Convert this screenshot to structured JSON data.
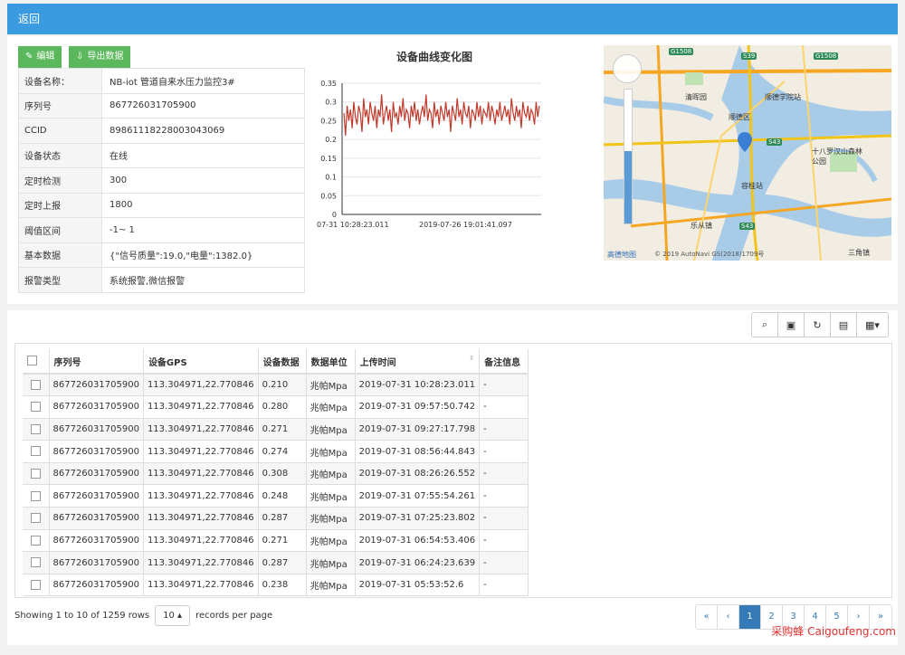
{
  "header": {
    "back_label": "返回"
  },
  "actions": {
    "edit_label": "编辑",
    "export_label": "导出数据"
  },
  "device": [
    {
      "key": "设备名称：",
      "value": "NB-iot 管道自来水压力监控3#"
    },
    {
      "key": "序列号",
      "value": "867726031705900"
    },
    {
      "key": "CCID",
      "value": "89861118228003043069"
    },
    {
      "key": "设备状态",
      "value": "在线"
    },
    {
      "key": "定时检测",
      "value": "300"
    },
    {
      "key": "定时上报",
      "value": "1800"
    },
    {
      "key": "阈值区间",
      "value": "-1~ 1"
    },
    {
      "key": "基本数据",
      "value": "{\"信号质量\":19.0,\"电量\":1382.0}"
    },
    {
      "key": "报警类型",
      "value": "系统报警,微信报警"
    }
  ],
  "chart_data": {
    "type": "line",
    "title": "设备曲线变化图",
    "xlabel": "",
    "ylabel": "",
    "ylim": [
      0,
      0.35
    ],
    "yticks": [
      "0.35",
      "0.3",
      "0.25",
      "0.2",
      "0.15",
      "0.1",
      "0.05",
      "0"
    ],
    "xticks": [
      "07-31 10:28:23.011",
      "2019-07-26 19:01:41.097"
    ],
    "color": "#c0392b",
    "series": [
      {
        "values": [
          0.27,
          0.21,
          0.29,
          0.25,
          0.28,
          0.23,
          0.3,
          0.26,
          0.24,
          0.29,
          0.27,
          0.22,
          0.31,
          0.26,
          0.28,
          0.24,
          0.3,
          0.27,
          0.25,
          0.29,
          0.23,
          0.28,
          0.26,
          0.32,
          0.24,
          0.27,
          0.29,
          0.25,
          0.28,
          0.22,
          0.3,
          0.26,
          0.27,
          0.24,
          0.29,
          0.26,
          0.31,
          0.25,
          0.28,
          0.27,
          0.23,
          0.29,
          0.26,
          0.3,
          0.25,
          0.28,
          0.24,
          0.27,
          0.29,
          0.26,
          0.32,
          0.25,
          0.28,
          0.27,
          0.23,
          0.3,
          0.26,
          0.28,
          0.24,
          0.29,
          0.27,
          0.25,
          0.3,
          0.26,
          0.28,
          0.22,
          0.29,
          0.27,
          0.25,
          0.31,
          0.26,
          0.28,
          0.24,
          0.3,
          0.27,
          0.26,
          0.29,
          0.23,
          0.28,
          0.27,
          0.25,
          0.3,
          0.26,
          0.29,
          0.24,
          0.28,
          0.27,
          0.26,
          0.3,
          0.25,
          0.29,
          0.27,
          0.24,
          0.28,
          0.26,
          0.3,
          0.25,
          0.27,
          0.29,
          0.26,
          0.28,
          0.24,
          0.31,
          0.27,
          0.25,
          0.29,
          0.26,
          0.28,
          0.23,
          0.3,
          0.27,
          0.26,
          0.29,
          0.25,
          0.28,
          0.27,
          0.24,
          0.3,
          0.26,
          0.29
        ]
      }
    ]
  },
  "map": {
    "labels": [
      "顺德区",
      "容桂站",
      "十八罗汉山森林公园",
      "清晖园",
      "顺德学院站",
      "乐从镇",
      "三角镇"
    ],
    "badges": [
      "G1508",
      "S39",
      "G1508",
      "S43",
      "S43"
    ],
    "copyright": "© 2019 AutoNavi GS(2018)1709号",
    "brand": "高德地图"
  },
  "toolbar": {
    "icons": [
      "search-icon",
      "toggle-icon",
      "refresh-icon",
      "columns-icon",
      "grid-icon"
    ]
  },
  "table": {
    "headers": [
      "序列号",
      "设备GPS",
      "设备数据",
      "数据单位",
      "上传时间",
      "备注信息"
    ],
    "rows": [
      [
        "867726031705900",
        "113.304971,22.770846",
        "0.210",
        "兆帕Mpa",
        "2019-07-31 10:28:23.011",
        "-"
      ],
      [
        "867726031705900",
        "113.304971,22.770846",
        "0.280",
        "兆帕Mpa",
        "2019-07-31 09:57:50.742",
        "-"
      ],
      [
        "867726031705900",
        "113.304971,22.770846",
        "0.271",
        "兆帕Mpa",
        "2019-07-31 09:27:17.798",
        "-"
      ],
      [
        "867726031705900",
        "113.304971,22.770846",
        "0.274",
        "兆帕Mpa",
        "2019-07-31 08:56:44.843",
        "-"
      ],
      [
        "867726031705900",
        "113.304971,22.770846",
        "0.308",
        "兆帕Mpa",
        "2019-07-31 08:26:26.552",
        "-"
      ],
      [
        "867726031705900",
        "113.304971,22.770846",
        "0.248",
        "兆帕Mpa",
        "2019-07-31 07:55:54.261",
        "-"
      ],
      [
        "867726031705900",
        "113.304971,22.770846",
        "0.287",
        "兆帕Mpa",
        "2019-07-31 07:25:23.802",
        "-"
      ],
      [
        "867726031705900",
        "113.304971,22.770846",
        "0.271",
        "兆帕Mpa",
        "2019-07-31 06:54:53.406",
        "-"
      ],
      [
        "867726031705900",
        "113.304971,22.770846",
        "0.287",
        "兆帕Mpa",
        "2019-07-31 06:24:23.639",
        "-"
      ],
      [
        "867726031705900",
        "113.304971,22.770846",
        "0.238",
        "兆帕Mpa",
        "2019-07-31 05:53:52.6",
        "-"
      ]
    ]
  },
  "footer": {
    "showing": "Showing 1 to 10 of 1259 rows",
    "page_size": "10 ▴",
    "records_per_page": "records per page"
  },
  "pagination": [
    "«",
    "‹",
    "1",
    "2",
    "3",
    "4",
    "5",
    "›",
    "»"
  ],
  "watermark": "采购蜂 Caigoufeng.com"
}
